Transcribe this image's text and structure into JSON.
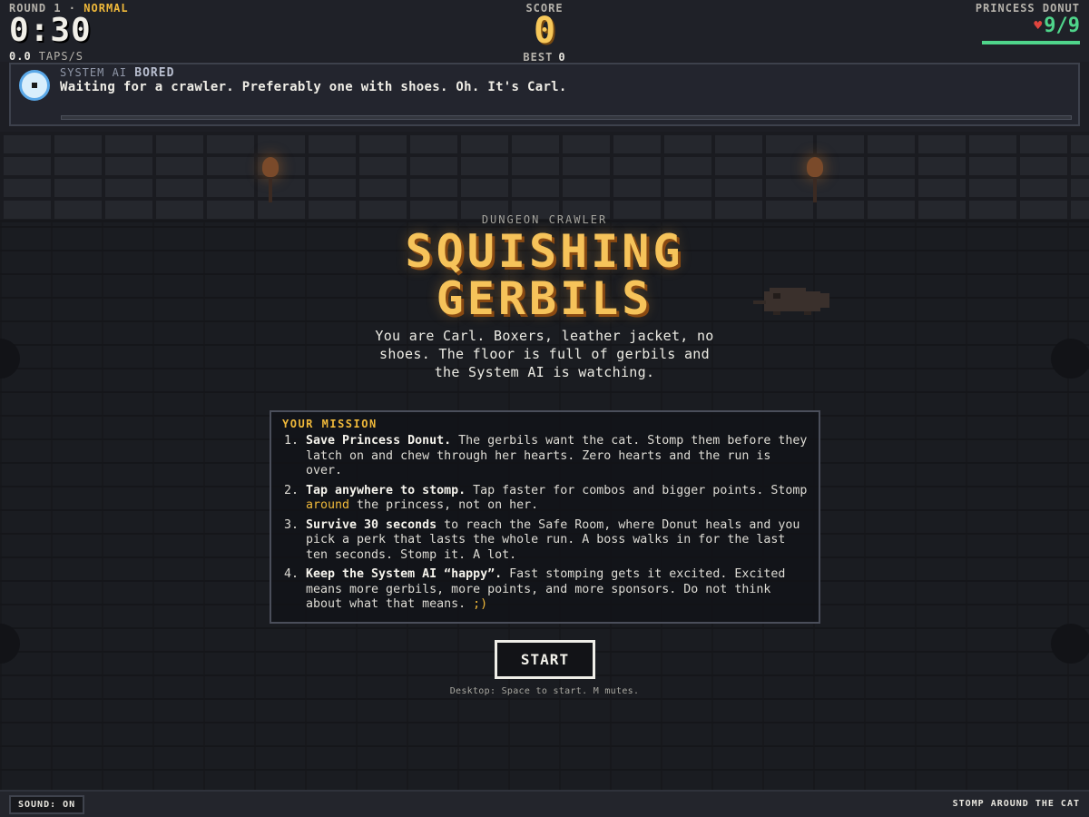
{
  "hud": {
    "round_label": "ROUND 1 ·",
    "difficulty": "NORMAL",
    "timer": "0:30",
    "taps_value": "0.0",
    "taps_label": "TAPS/S",
    "score_label": "SCORE",
    "score_value": "0",
    "best_label": "BEST",
    "best_value": "0",
    "princess_label": "PRINCESS DONUT",
    "hearts": "9/9",
    "hp_fraction": 1.0
  },
  "system_ai": {
    "title": "SYSTEM AI",
    "mood": "BORED",
    "message": "Waiting for a crawler. Preferably one with shoes. Oh. It's Carl."
  },
  "intro": {
    "subtitle": "DUNGEON CRAWLER",
    "title_line1": "SQUISHING",
    "title_line2": "GERBILS",
    "description": "You are Carl. Boxers, leather jacket, no shoes. The floor is full of gerbils and the System AI is watching."
  },
  "mission": {
    "heading": "YOUR MISSION",
    "items": [
      {
        "bold": "Save Princess Donut.",
        "text": " The gerbils want the cat. Stomp them before they latch on and chew through her hearts. Zero hearts and the run is over."
      },
      {
        "bold": "Tap anywhere to stomp.",
        "text_a": " Tap faster for combos and bigger points. Stomp ",
        "highlight": "around",
        "text_b": " the princess, not on her."
      },
      {
        "bold": "Survive 30 seconds",
        "text": " to reach the Safe Room, where Donut heals and you pick a perk that lasts the whole run. A boss walks in for the last ten seconds. Stomp it. A lot."
      },
      {
        "bold": "Keep the System AI “happy”.",
        "text_a": " Fast stomping gets it excited. Excited means more gerbils, more points, and more sponsors. Do not think about what that means. ",
        "highlight": ";)"
      }
    ]
  },
  "start_button": "START",
  "hint": "Desktop: Space to start. M mutes.",
  "footer": {
    "sound": "SOUND: ON",
    "tagline": "STOMP AROUND THE CAT"
  },
  "icons": {
    "ai": "eye-icon",
    "heart": "heart-icon"
  },
  "colors": {
    "accent": "#f6c35a",
    "hp": "#4fd58b",
    "heart": "#e0453e"
  }
}
